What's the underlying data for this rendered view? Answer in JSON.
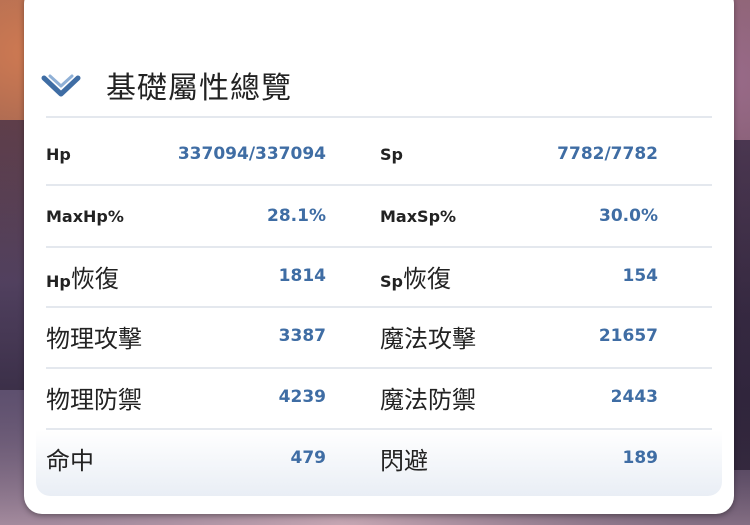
{
  "panel": {
    "title": "基礎屬性總覽",
    "icons": {
      "toggle": "chevron-down-icon"
    }
  },
  "colors": {
    "panel_bg": "#ffffff",
    "label": "#222222",
    "value": "#3f6da4",
    "divider": "#e4e8ee"
  },
  "stats": [
    {
      "left_label": "Hp",
      "left_value": "337094/337094",
      "right_label": "Sp",
      "right_value": "7782/7782"
    },
    {
      "left_label": "MaxHp%",
      "left_value": "28.1%",
      "right_label": "MaxSp%",
      "right_value": "30.0%"
    },
    {
      "left_label_latin": "Hp",
      "left_label_cjk": "恢復",
      "left_value": "1814",
      "right_label_latin": "Sp",
      "right_label_cjk": "恢復",
      "right_value": "154"
    },
    {
      "left_label": "物理攻擊",
      "left_value": "3387",
      "right_label": "魔法攻擊",
      "right_value": "21657"
    },
    {
      "left_label": "物理防禦",
      "left_value": "4239",
      "right_label": "魔法防禦",
      "right_value": "2443"
    },
    {
      "left_label": "命中",
      "left_value": "479",
      "right_label": "閃避",
      "right_value": "189"
    }
  ]
}
